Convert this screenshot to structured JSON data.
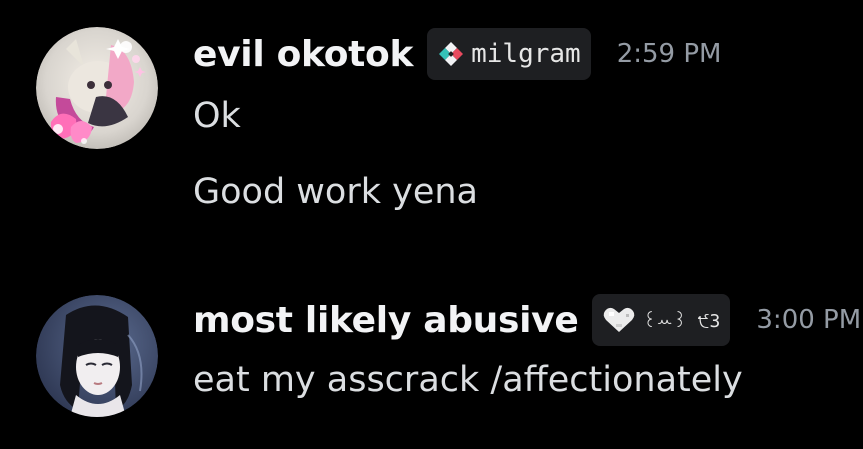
{
  "messages": [
    {
      "username": "evil okotok",
      "tag": {
        "icon": "diamond-emblem-icon",
        "text": "milgram"
      },
      "timestamp": "2:59 PM",
      "lines": [
        "Ok",
        "Good work yena"
      ]
    },
    {
      "username": "most likely abusive",
      "tag": {
        "icon": "heart-icon",
        "text": "꒰ꕀ꒱ ੯3"
      },
      "timestamp": "3:00 PM",
      "lines": [
        "eat my asscrack /affectionately"
      ]
    }
  ],
  "colors": {
    "background": "#000000",
    "username": "#f2f3f5",
    "message_text": "#dbdee1",
    "timestamp": "#949ba4",
    "tag_background": "#1e1f22"
  }
}
